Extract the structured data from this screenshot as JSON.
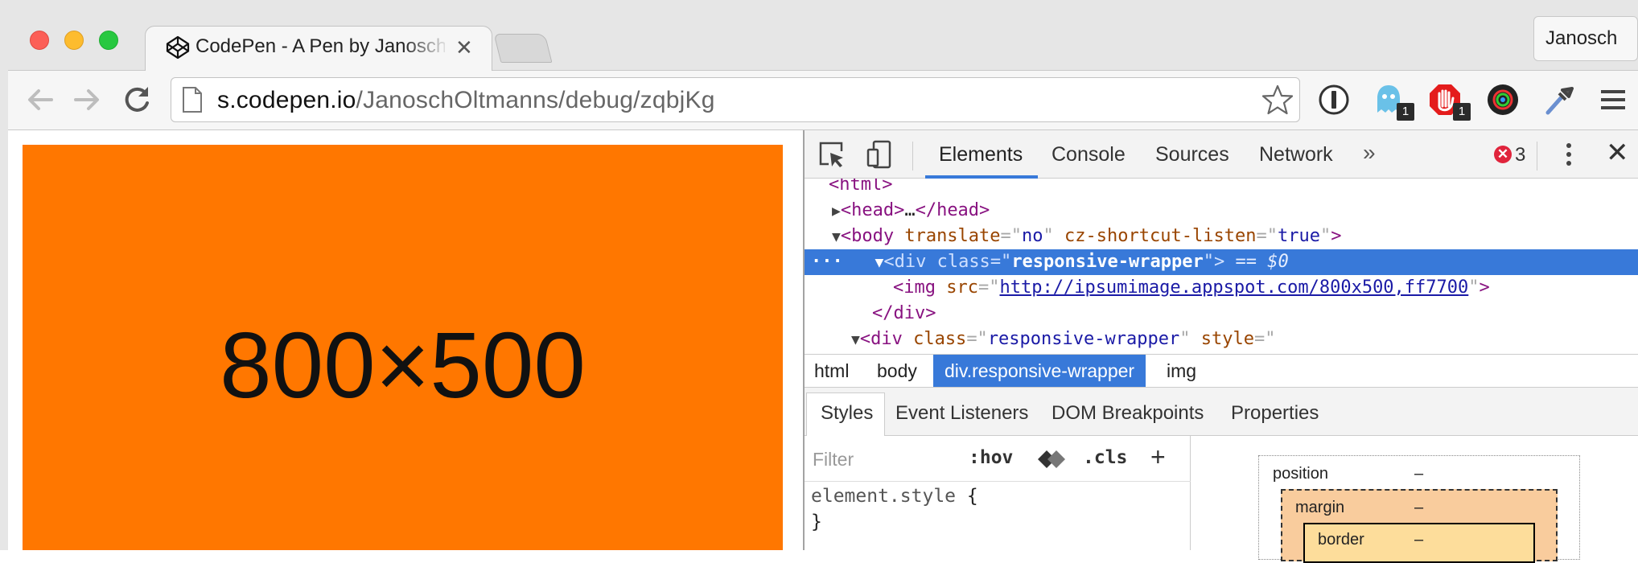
{
  "window": {
    "tab_title": "CodePen - A Pen by Janosch Oltmanns",
    "profile_name": "Janosch"
  },
  "toolbar": {
    "url_host": "s.codepen.io",
    "url_path": "/JanoschOltmanns/debug/zqbjKg",
    "extensions": [
      {
        "icon": "1password-icon"
      },
      {
        "icon": "ghostery-icon",
        "badge": "1"
      },
      {
        "icon": "adblock-icon",
        "badge": "1"
      },
      {
        "icon": "colorzilla-icon"
      },
      {
        "icon": "eyedropper-icon"
      }
    ]
  },
  "page": {
    "image_text": "800×500",
    "image_color": "#ff7700"
  },
  "devtools": {
    "tabs": [
      "Elements",
      "Console",
      "Sources",
      "Network"
    ],
    "more": "»",
    "error_count": "3",
    "dom": {
      "l0_tag": "<html>",
      "l1_open": "<head>",
      "l1_ellipsis": "…",
      "l1_close": "</head>",
      "l2_tag_open": "<body",
      "l2_attr1": "translate",
      "l2_val1": "no",
      "l2_attr2": "cz-shortcut-listen",
      "l2_val2": "true",
      "l3_dots": "···",
      "l3_tag_open": "<div",
      "l3_attr": "class",
      "l3_val": "responsive-wrapper",
      "l3_eq": "== $0",
      "l4_tag_open": "<img",
      "l4_attr": "src",
      "l4_val": "http://ipsumimage.appspot.com/800x500,ff7700",
      "l5_tag": "</div>",
      "l6_tag_open": "<div",
      "l6_attr1": "class",
      "l6_val1": "responsive-wrapper",
      "l6_attr2": "style"
    },
    "breadcrumbs": [
      "html",
      "body",
      "div.responsive-wrapper",
      "img"
    ],
    "subtabs": [
      "Styles",
      "Event Listeners",
      "DOM Breakpoints",
      "Properties"
    ],
    "styles": {
      "filter_placeholder": "Filter",
      "hov": ":hov",
      "cls": ".cls",
      "plus": "+",
      "rule_selector": "element.style",
      "open_brace": "{",
      "close_brace": "}"
    },
    "box_model": {
      "position_label": "position",
      "position_value": "–",
      "margin_label": "margin",
      "margin_value": "–",
      "border_label": "border",
      "border_value": "–"
    }
  }
}
